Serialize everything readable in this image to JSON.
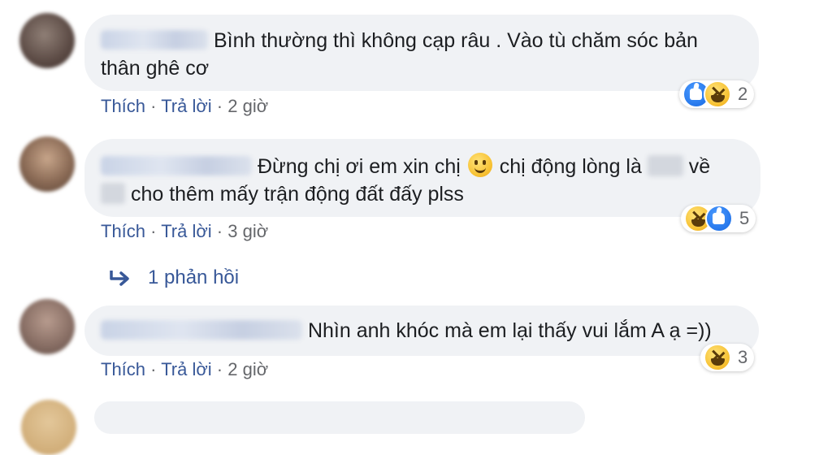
{
  "comments": [
    {
      "text": "Bình thường thì không cạp râu . Vào tù chăm sóc bản thân ghê cơ",
      "line1": "Bình thường thì không cạp râu . Vào tù chăm sóc bản",
      "line2": "thân ghê cơ",
      "actions": {
        "like": "Thích",
        "reply": "Trả lời",
        "time": "2 giờ"
      },
      "reactions": [
        "like",
        "haha"
      ],
      "reaction_count": "2"
    },
    {
      "line1a": "Đừng chị ơi em xin chị",
      "line1b": "chị động lòng là",
      "line1c": "về",
      "line2": "cho thêm mấy trận động đất đấy plss",
      "actions": {
        "like": "Thích",
        "reply": "Trả lời",
        "time": "3 giờ"
      },
      "reactions": [
        "haha",
        "like"
      ],
      "reaction_count": "5",
      "replies_label": "1 phản hồi"
    },
    {
      "text": "Nhìn anh khóc mà em lại thấy vui lắm A ạ =))",
      "actions": {
        "like": "Thích",
        "reply": "Trả lời",
        "time": "2 giờ"
      },
      "reactions": [
        "haha"
      ],
      "reaction_count": "3"
    }
  ],
  "separator": " · ",
  "colors": {
    "bubble": "#f0f2f5",
    "link": "#385898",
    "meta": "#65676b",
    "like": "#1877f2"
  }
}
